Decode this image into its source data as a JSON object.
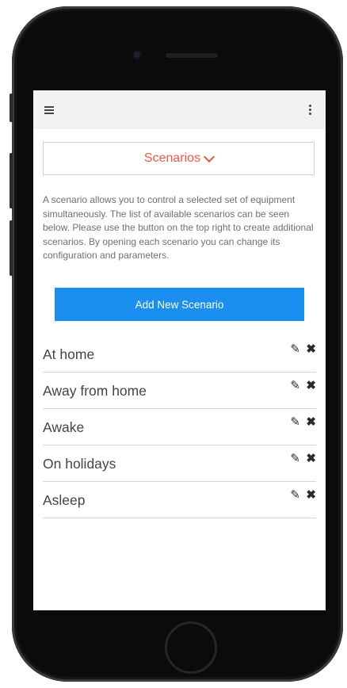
{
  "header": {
    "menu_icon": "hamburger-menu-icon",
    "more_icon": "vertical-ellipsis-icon"
  },
  "selector": {
    "label": "Scenarios",
    "icon": "chevron-down-icon",
    "accent_color": "#f0593f"
  },
  "description": "A scenario allows you to control a selected set of equipment simultaneously. The list of available scenarios can be seen below. Please use the button on the top right to create additional scenarios. By opening each scenario you can change its configuration and parameters.",
  "add_button": {
    "label": "Add New Scenario",
    "color": "#1a8ff0"
  },
  "scenarios": [
    {
      "name": "At home",
      "edit_icon": "✎",
      "delete_icon": "✖"
    },
    {
      "name": "Away from home",
      "edit_icon": "✎",
      "delete_icon": "✖"
    },
    {
      "name": "Awake",
      "edit_icon": "✎",
      "delete_icon": "✖"
    },
    {
      "name": "On holidays",
      "edit_icon": "✎",
      "delete_icon": "✖"
    },
    {
      "name": "Asleep",
      "edit_icon": "✎",
      "delete_icon": "✖"
    }
  ]
}
